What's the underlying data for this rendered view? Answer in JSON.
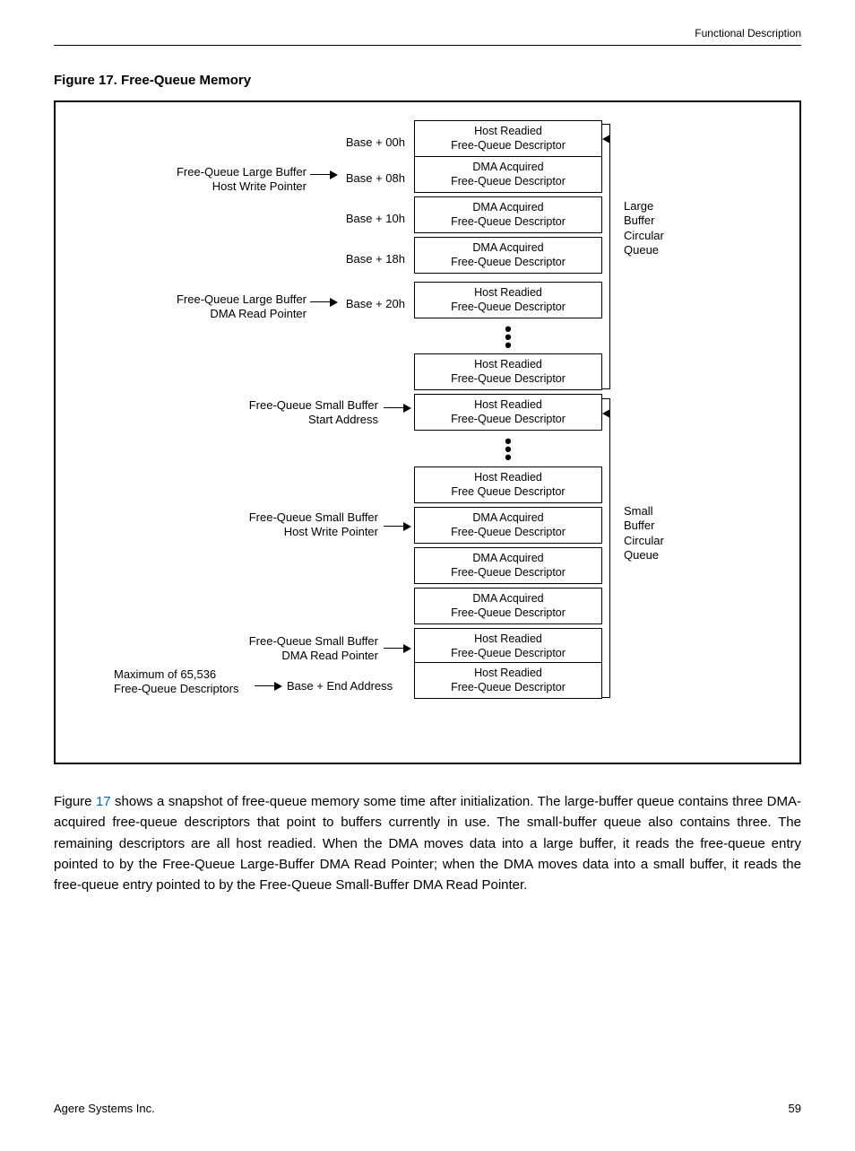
{
  "header": {
    "section": "Functional Description"
  },
  "figure": {
    "caption_prefix": "Figure 17.",
    "caption": "Free-Queue Memory"
  },
  "diagram": {
    "addresses": [
      "Base + 00h",
      "Base + 08h",
      "Base + 10h",
      "Base + 18h",
      "Base + 20h",
      "Base + End Address"
    ],
    "left_labels": {
      "large_host_write": {
        "l1": "Free-Queue Large Buffer",
        "l2": "Host Write Pointer"
      },
      "large_dma_read": {
        "l1": "Free-Queue Large Buffer",
        "l2": "DMA Read Pointer"
      },
      "small_start": {
        "l1": "Free-Queue Small Buffer",
        "l2": "Start Address"
      },
      "small_host_write": {
        "l1": "Free-Queue Small Buffer",
        "l2": "Host Write Pointer"
      },
      "small_dma_read": {
        "l1": "Free-Queue Small Buffer",
        "l2": "DMA Read Pointer"
      },
      "maximum": {
        "l1": "Maximum of 65,536",
        "l2": "Free-Queue Descriptors"
      }
    },
    "large_boxes": [
      {
        "l1": "Host Readied",
        "l2": "Free-Queue Descriptor"
      },
      {
        "l1": "DMA Acquired",
        "l2": "Free-Queue Descriptor"
      },
      {
        "l1": "DMA Acquired",
        "l2": "Free-Queue Descriptor"
      },
      {
        "l1": "DMA Acquired",
        "l2": "Free-Queue Descriptor"
      },
      {
        "l1": "Host Readied",
        "l2": "Free-Queue Descriptor"
      },
      {
        "l1": "Host Readied",
        "l2": "Free-Queue Descriptor"
      }
    ],
    "small_boxes": [
      {
        "l1": "Host Readied",
        "l2": "Free-Queue Descriptor"
      },
      {
        "l1": "Host Readied",
        "l2": "Free Queue Descriptor"
      },
      {
        "l1": "DMA Acquired",
        "l2": "Free-Queue Descriptor"
      },
      {
        "l1": "DMA Acquired",
        "l2": "Free-Queue Descriptor"
      },
      {
        "l1": "DMA Acquired",
        "l2": "Free-Queue Descriptor"
      },
      {
        "l1": "Host Readied",
        "l2": "Free-Queue Descriptor"
      },
      {
        "l1": "Host Readied",
        "l2": "Free-Queue Descriptor"
      }
    ],
    "right_labels": {
      "large": {
        "l1": "Large",
        "l2": "Buffer",
        "l3": "Circular",
        "l4": "Queue"
      },
      "small": {
        "l1": "Small",
        "l2": "Buffer",
        "l3": "Circular",
        "l4": "Queue"
      }
    }
  },
  "body": {
    "p1a": "Figure ",
    "figref": "17",
    "p1b": " shows a snapshot of free-queue memory some time after initialization. The large-buffer queue contains three DMA-acquired free-queue descriptors that point to buffers currently in use. The small-buffer queue also contains three. The remaining descriptors are all host readied. When the DMA moves data into a large buffer, it reads the free-queue entry pointed to by the Free-Queue Large-Buffer DMA Read Pointer; when the DMA moves data into a small buffer, it reads the free-queue entry pointed to by the Free-Queue Small-Buffer DMA Read Pointer."
  },
  "footer": {
    "left": "Agere Systems Inc.",
    "right": "59"
  }
}
